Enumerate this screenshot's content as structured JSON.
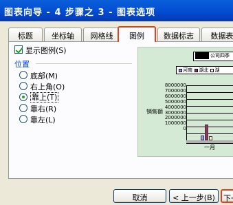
{
  "window": {
    "title": "图表向导 - 4 步骤之 3 - 图表选项"
  },
  "tabs": [
    "标题",
    "坐标轴",
    "网格线",
    "图例",
    "数据标志",
    "数据表"
  ],
  "active_tab": "图例",
  "show_legend": {
    "label": "显示图例(S)",
    "checked": true
  },
  "position": {
    "title": "位置",
    "options": [
      {
        "label": "底部(M)",
        "selected": false
      },
      {
        "label": "右上角(O)",
        "selected": false
      },
      {
        "label": "靠上(T)",
        "selected": true
      },
      {
        "label": "靠右(R)",
        "selected": false
      },
      {
        "label": "靠左(L)",
        "selected": false
      }
    ]
  },
  "preview": {
    "title_snippet": "公司四季",
    "legend_items": [
      "河南",
      "湖北",
      "湖"
    ],
    "y_ticks": [
      "8000000",
      "7000000",
      "6000000",
      "5000000",
      "4000000",
      "3000000",
      "2000000",
      "1000000",
      "0"
    ],
    "y_label": "销售额",
    "x_label": "一月",
    "colors": {
      "bg": "#d4ead5",
      "bar1": "#9999ff",
      "bar2": "#993366",
      "bar3": "#ffffcc"
    }
  },
  "chart_data": {
    "type": "bar",
    "categories": [
      "一月"
    ],
    "series": [
      {
        "name": "河南",
        "values": [
          700000
        ]
      },
      {
        "name": "湖北",
        "values": [
          2300000
        ]
      },
      {
        "name": "湖",
        "values": [
          600000
        ]
      }
    ],
    "ylabel": "销售额",
    "ylim": [
      0,
      8000000
    ]
  },
  "buttons": {
    "cancel": "取消",
    "back": "< 上一步(B)",
    "next": "下一"
  }
}
